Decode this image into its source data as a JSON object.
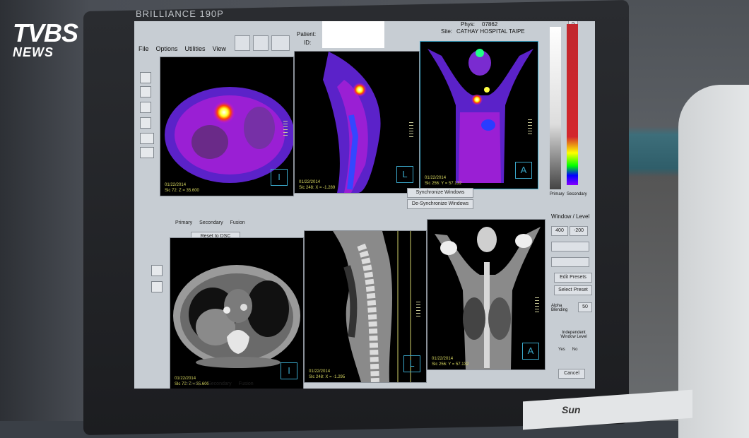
{
  "overlay": {
    "logo_top": "TVBS",
    "logo_bottom": "NEWS"
  },
  "monitor": {
    "brand": "BRILLIANCE 190P",
    "keyboard_brand": "Sun"
  },
  "app": {
    "menu": [
      "File",
      "Options",
      "Utilities",
      "View"
    ],
    "patient_label": "Patient:",
    "id_label": "ID:",
    "phys_label": "Phys:",
    "phys_value": "07862",
    "site_label": "Site:",
    "site_value": "CATHAY HOSPITAL TAIPE",
    "help": "?"
  },
  "panels": {
    "pet_axial": {
      "date": "01/22/2014",
      "slice": "Slc 72: Z = 35.600",
      "orient": "I"
    },
    "pet_sagittal": {
      "date": "01/22/2014",
      "slice": "Slc 248: X = -1.289",
      "orient": "L"
    },
    "pet_coronal": {
      "date": "01/22/2014",
      "slice": "Slc 256: Y = 57.132",
      "orient": "A"
    },
    "ct_axial": {
      "date": "01/22/2014",
      "slice": "Slc 72: Z = 35.600",
      "orient": "I"
    },
    "ct_sagittal": {
      "date": "01/22/2014",
      "slice": "Slc 248: X = -1.295",
      "orient": "L"
    },
    "ct_coronal": {
      "date": "01/22/2014",
      "slice": "Slc 256: Y = 57.132",
      "orient": "A"
    }
  },
  "controls": {
    "sync_windows": "Synchronize Windows",
    "desync_windows": "De-Synchronize Windows",
    "radio_primary": "Primary",
    "radio_secondary": "Secondary",
    "radio_fusion": "Fusion",
    "reset_btn": "Reset to DSC",
    "primary_label": "Primary",
    "secondary_label": "Secondary",
    "window_level": "Window / Level",
    "wl_val1": "400",
    "wl_val2": "-200",
    "edit_presets": "Edit Presets",
    "select_preset": "Select Preset",
    "alpha_blending": "Alpha Blending",
    "alpha_value": "50",
    "independent": "Independent Window Level",
    "yes": "Yes",
    "no": "No",
    "cancel": "Cancel"
  }
}
